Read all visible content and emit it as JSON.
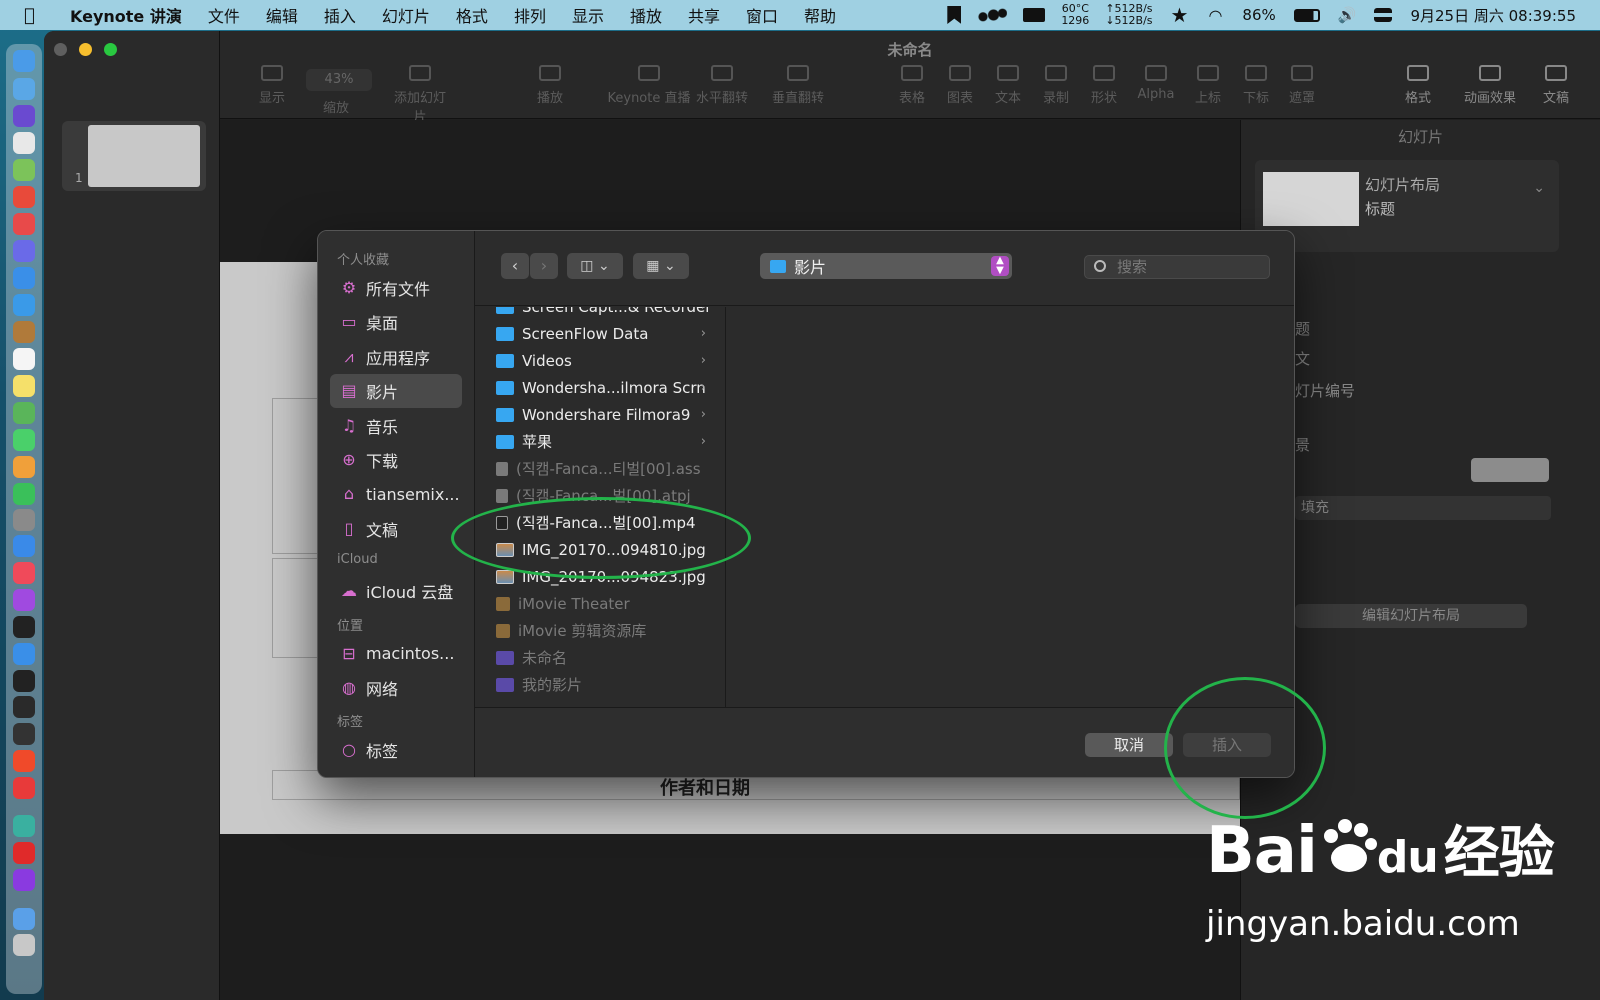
{
  "menubar": {
    "app_name": "Keynote 讲演",
    "menus": [
      "文件",
      "编辑",
      "插入",
      "幻灯片",
      "格式",
      "排列",
      "显示",
      "播放",
      "共享",
      "窗口",
      "帮助"
    ],
    "temp": "60°C",
    "fan": "1296",
    "net_up": "↑512B/s",
    "net_down": "↓512B/s",
    "battery": "86%",
    "datetime": "9月25日 周六  08:39:55"
  },
  "window": {
    "title": "未命名",
    "slide_number": "1",
    "toolbar": [
      {
        "label": "显示",
        "icon": "view-icon"
      },
      {
        "label": "缩放",
        "icon": "zoom-icon",
        "value": "43%"
      },
      {
        "label": "添加幻灯片",
        "icon": "add-slide-icon"
      },
      {
        "label": "播放",
        "icon": "play-icon"
      },
      {
        "label": "Keynote 直播",
        "icon": "live-icon"
      },
      {
        "label": "水平翻转",
        "icon": "flip-horizontal-icon"
      },
      {
        "label": "垂直翻转",
        "icon": "flip-vertical-icon"
      },
      {
        "label": "表格",
        "icon": "table-icon"
      },
      {
        "label": "图表",
        "icon": "chart-icon"
      },
      {
        "label": "文本",
        "icon": "text-icon"
      },
      {
        "label": "录制",
        "icon": "record-icon"
      },
      {
        "label": "形状",
        "icon": "shape-icon"
      },
      {
        "label": "Alpha",
        "icon": "alpha-icon"
      },
      {
        "label": "上标",
        "icon": "superscript-icon"
      },
      {
        "label": "下标",
        "icon": "subscript-icon"
      },
      {
        "label": "遮罩",
        "icon": "mask-icon"
      },
      {
        "label": "格式",
        "icon": "format-icon"
      },
      {
        "label": "动画效果",
        "icon": "animate-icon"
      },
      {
        "label": "文稿",
        "icon": "document-icon"
      }
    ],
    "slide_author_text": "作者和日期"
  },
  "inspector": {
    "tab": "幻灯片",
    "layout_label": "幻灯片布局",
    "layout_value": "标题",
    "rows": [
      "题",
      "文",
      "灯片编号",
      "景"
    ],
    "fill_label": "填充",
    "edit_layout_button": "编辑幻灯片布局"
  },
  "dialog": {
    "sidebar": {
      "sections": [
        {
          "title": "个人收藏",
          "items": [
            {
              "label": "所有文件",
              "icon": "gear-icon"
            },
            {
              "label": "桌面",
              "icon": "desktop-icon"
            },
            {
              "label": "应用程序",
              "icon": "applications-icon"
            },
            {
              "label": "影片",
              "icon": "movies-icon",
              "selected": true
            },
            {
              "label": "音乐",
              "icon": "music-icon"
            },
            {
              "label": "下载",
              "icon": "download-icon"
            },
            {
              "label": "tiansemix...",
              "icon": "home-icon"
            },
            {
              "label": "文稿",
              "icon": "document-icon"
            }
          ]
        },
        {
          "title": "iCloud",
          "items": [
            {
              "label": "iCloud 云盘",
              "icon": "cloud-icon"
            }
          ]
        },
        {
          "title": "位置",
          "items": [
            {
              "label": "macintos...",
              "icon": "disk-icon"
            },
            {
              "label": "网络",
              "icon": "network-icon"
            }
          ]
        },
        {
          "title": "标签",
          "items": [
            {
              "label": "标签",
              "icon": "tag-icon"
            }
          ]
        }
      ]
    },
    "location": "影片",
    "search_placeholder": "搜索",
    "files": [
      {
        "name": "Screen Capt...& Recorder",
        "kind": "folder",
        "dim": false,
        "chevron": true
      },
      {
        "name": "ScreenFlow Data",
        "kind": "folder",
        "dim": false,
        "chevron": true
      },
      {
        "name": "Videos",
        "kind": "folder",
        "dim": false,
        "chevron": true
      },
      {
        "name": "Wondersha...ilmora Scrn",
        "kind": "folder",
        "dim": false,
        "chevron": true
      },
      {
        "name": "Wondershare Filmora9",
        "kind": "folder",
        "dim": false,
        "chevron": true
      },
      {
        "name": "苹果",
        "kind": "folder",
        "dim": false,
        "chevron": true
      },
      {
        "name": "(직캠-Fanca...티벌[00].ass",
        "kind": "doc",
        "dim": true,
        "chevron": false
      },
      {
        "name": "(직캠-Fanca...벌[00].atpj",
        "kind": "doc",
        "dim": true,
        "chevron": false
      },
      {
        "name": "(직캠-Fanca...벌[00].mp4",
        "kind": "video",
        "dim": false,
        "chevron": false
      },
      {
        "name": "IMG_20170...094810.jpg",
        "kind": "image",
        "dim": false,
        "chevron": false
      },
      {
        "name": "IMG_20170...094823.jpg",
        "kind": "image",
        "dim": false,
        "chevron": false
      },
      {
        "name": "iMovie Theater",
        "kind": "imovie",
        "dim": true,
        "chevron": false
      },
      {
        "name": "iMovie 剪辑资源库",
        "kind": "imovie",
        "dim": true,
        "chevron": false
      },
      {
        "name": "未命名",
        "kind": "project",
        "dim": true,
        "chevron": false
      },
      {
        "name": "我的影片",
        "kind": "project",
        "dim": true,
        "chevron": false
      }
    ],
    "cancel_button": "取消",
    "insert_button": "插入"
  },
  "watermark": {
    "brand": "Bai",
    "brand2": "du",
    "suffix": "经验",
    "url": "jingyan.baidu.com"
  },
  "colors": {
    "menubar_bg": "#9fd0e2",
    "folder_blue": "#37a7f1",
    "annotation_green": "#23b34a",
    "stepper_purple": "#b14ec3"
  }
}
